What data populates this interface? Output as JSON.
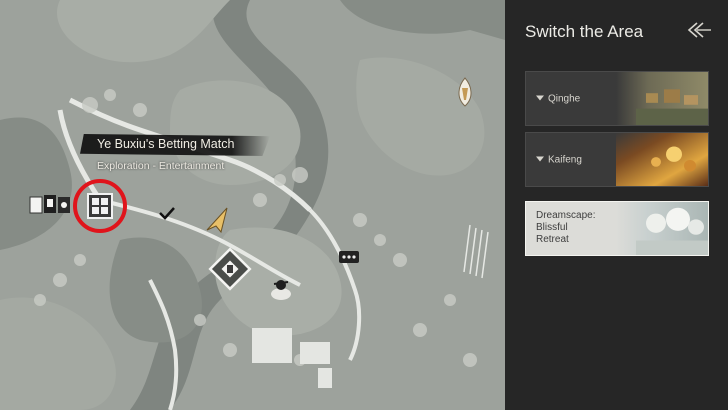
{
  "map": {
    "tooltip": {
      "title": "Ye Buxiu's Betting Match",
      "subtitle": "Exploration - Entertainment"
    }
  },
  "panel": {
    "title": "Switch the Area",
    "back_icon": "double-chevron-left-icon",
    "areas": [
      {
        "label": "Qinghe",
        "state": "collapsed"
      },
      {
        "label": "Kaifeng",
        "state": "collapsed"
      },
      {
        "label_lines": [
          "Dreamscape:",
          "Blissful",
          "Retreat"
        ],
        "state": "selected"
      }
    ]
  },
  "colors": {
    "land": "#9da29c",
    "water": "#7f8580",
    "highlight_ring": "#e0141b",
    "player_marker": "#e8c068",
    "panel_bg": "#262626"
  }
}
